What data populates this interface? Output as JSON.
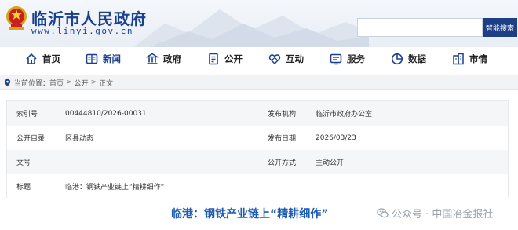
{
  "header": {
    "site_title": "临沂市人民政府",
    "site_url": "www.linyi.gov.cn",
    "search": {
      "placeholder": "",
      "button_label": "智能搜索"
    }
  },
  "nav": {
    "items": [
      {
        "label": "首页",
        "icon": "home-icon"
      },
      {
        "label": "新闻",
        "icon": "news-icon",
        "active": true
      },
      {
        "label": "政府",
        "icon": "government-icon"
      },
      {
        "label": "公开",
        "icon": "disclosure-icon"
      },
      {
        "label": "互动",
        "icon": "interaction-icon"
      },
      {
        "label": "服务",
        "icon": "service-icon"
      },
      {
        "label": "数据",
        "icon": "data-icon"
      },
      {
        "label": "市情",
        "icon": "city-info-icon"
      }
    ]
  },
  "breadcrumb": {
    "prefix": "当前位置：",
    "items": [
      "首页",
      "公开",
      "正文"
    ],
    "separator": ">"
  },
  "info": {
    "index_label": "索引号",
    "index_value": "00444810/2026-00031",
    "publisher_label": "发布机构",
    "publisher_value": "临沂市政府办公室",
    "catalog_label": "公开目录",
    "catalog_value": "区县动态",
    "date_label": "发布日期",
    "date_value": "2026/03/23",
    "docno_label": "文号",
    "docno_value": "",
    "method_label": "公开方式",
    "method_value": "主动公开",
    "title_label": "标题",
    "title_value": "临港：钢铁产业链上“精耕细作”"
  },
  "article": {
    "title": "临港：钢铁产业链上“精耕细作”"
  },
  "watermark": {
    "text": "公众号 · 中国冶金报社"
  },
  "colors": {
    "brand_blue": "#1b3f8f",
    "search_button": "#1d3f87",
    "article_title": "#1d5bb4"
  }
}
